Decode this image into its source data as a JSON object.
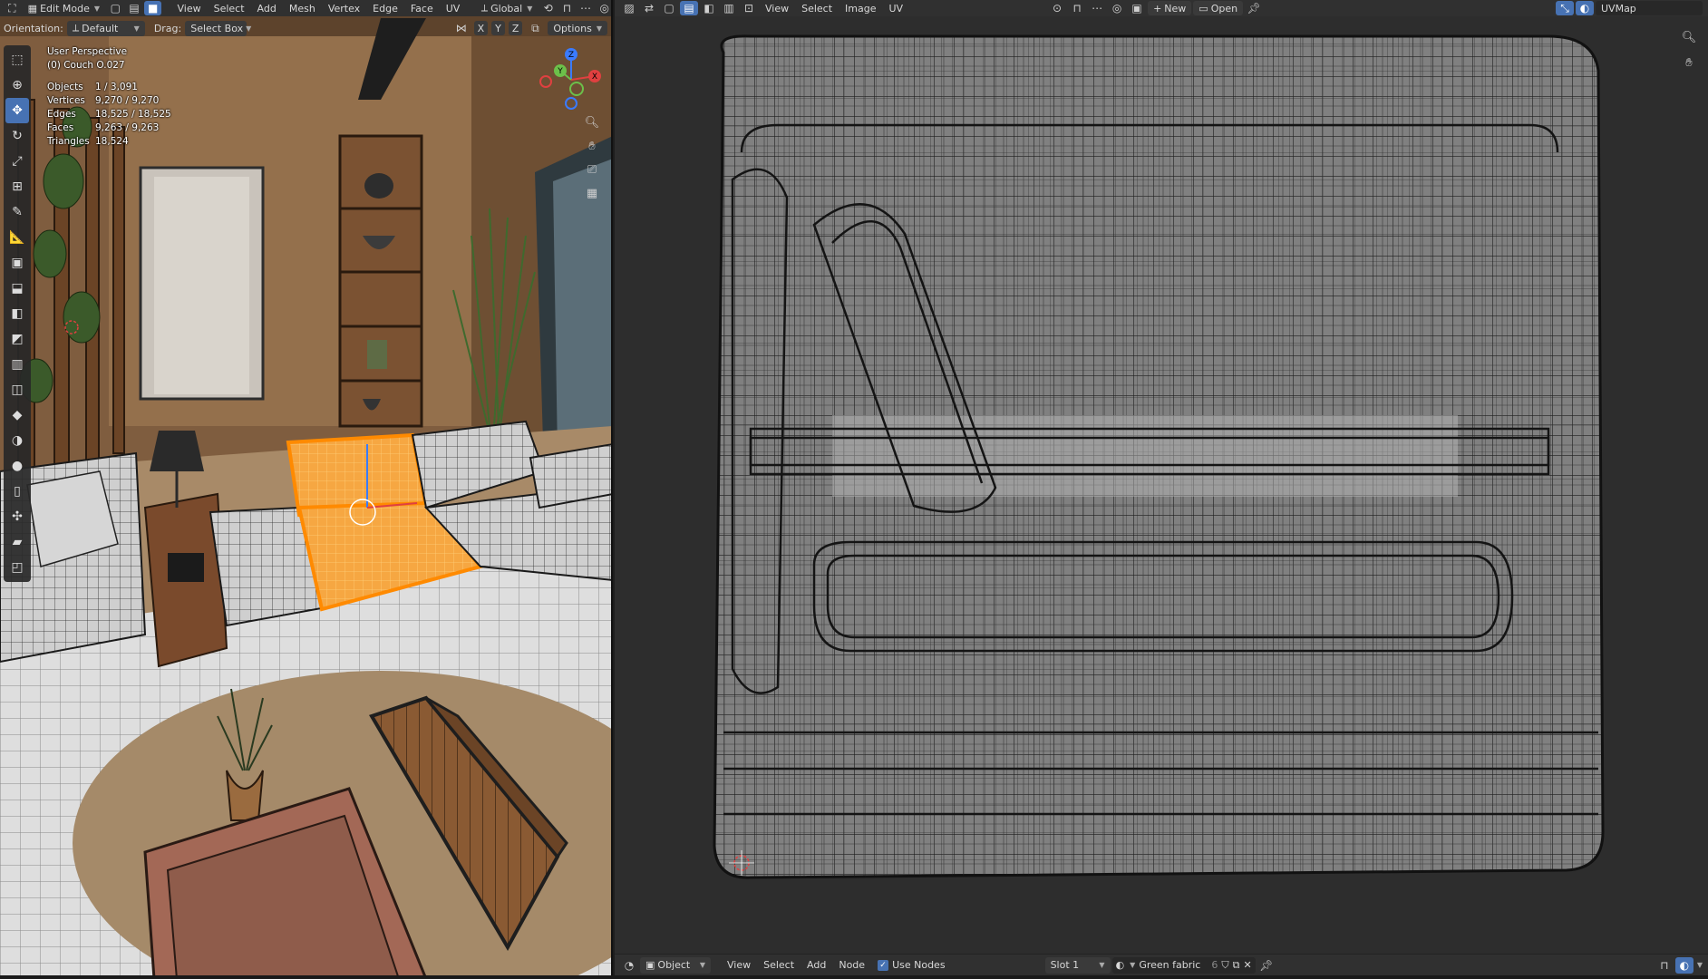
{
  "viewport3d": {
    "header": {
      "mode": "Edit Mode",
      "menus": [
        "View",
        "Select",
        "Add",
        "Mesh",
        "Vertex",
        "Edge",
        "Face",
        "UV"
      ],
      "transform_orientation": "Global"
    },
    "subheader": {
      "orientation_label": "Orientation:",
      "orientation_value": "Default",
      "drag_label": "Drag:",
      "drag_value": "Select Box",
      "axis_x": "X",
      "axis_y": "Y",
      "axis_z": "Z",
      "options_label": "Options"
    },
    "overlay": {
      "perspective": "User Perspective",
      "object_name": "(0) Couch O.027",
      "stats": [
        {
          "label": "Objects",
          "value": "1 / 3,091"
        },
        {
          "label": "Vertices",
          "value": "9,270 / 9,270"
        },
        {
          "label": "Edges",
          "value": "18,525 / 18,525"
        },
        {
          "label": "Faces",
          "value": "9,263 / 9,263"
        },
        {
          "label": "Triangles",
          "value": "18,524"
        }
      ]
    },
    "gizmo": {
      "x": "X",
      "y": "Y",
      "z": "Z"
    }
  },
  "uv_editor": {
    "header": {
      "menus": [
        "View",
        "Select",
        "Image",
        "UV"
      ],
      "new_label": "New",
      "open_label": "Open",
      "uvmap_name": "UVMap"
    }
  },
  "node_editor": {
    "header": {
      "object_label": "Object",
      "menus": [
        "View",
        "Select",
        "Add",
        "Node"
      ],
      "use_nodes_label": "Use Nodes",
      "slot_label": "Slot 1",
      "material_name": "Green fabric",
      "user_count": "6"
    }
  },
  "colors": {
    "accent": "#4772b3",
    "selection": "#ff9a1a",
    "wall": "#8e6a45",
    "floor": "#a88a68",
    "wire": "#1a1a1a"
  }
}
